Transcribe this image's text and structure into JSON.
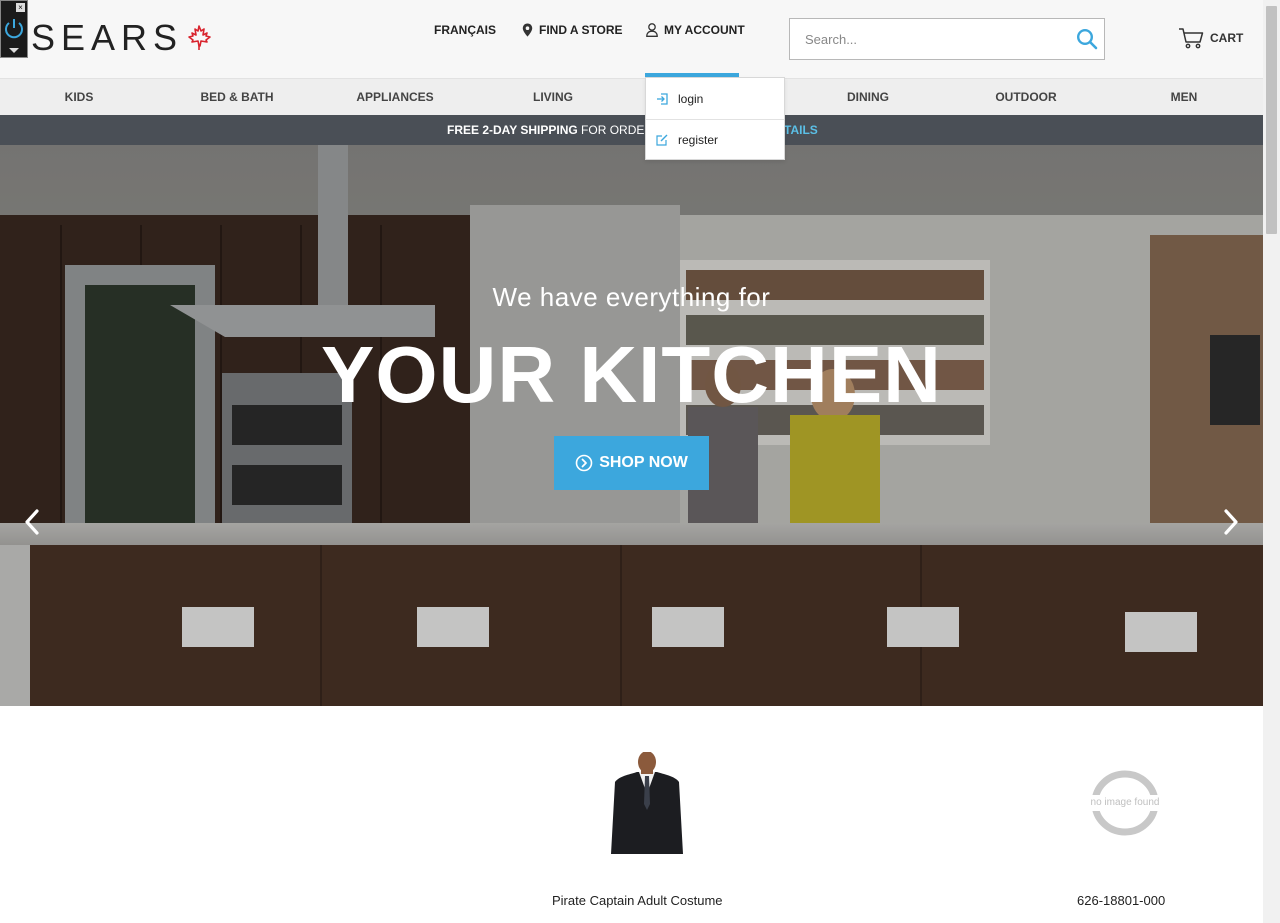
{
  "brand": {
    "logo_text": "SEARS"
  },
  "header": {
    "language_label": "FRANÇAIS",
    "find_store_label": "FIND A STORE",
    "account_label": "MY ACCOUNT",
    "cart_label": "CART"
  },
  "search": {
    "placeholder": "Search...",
    "value": ""
  },
  "account_menu": {
    "items": [
      {
        "label": "login",
        "icon": "login-icon"
      },
      {
        "label": "register",
        "icon": "edit-icon"
      }
    ]
  },
  "categories": [
    {
      "label": "KIDS"
    },
    {
      "label": "BED & BATH"
    },
    {
      "label": "APPLIANCES"
    },
    {
      "label": "LIVING"
    },
    {
      "label": "DINING"
    },
    {
      "label": "OUTDOOR"
    },
    {
      "label": "MEN"
    }
  ],
  "shipping_banner": {
    "bold": "FREE 2-DAY SHIPPING",
    "rest": " FOR ORDE",
    "link": "TAILS"
  },
  "hero": {
    "subtitle": "We have everything for",
    "title": "YOUR KITCHEN",
    "cta_label": "SHOP NOW"
  },
  "products": [
    {
      "name": "Pirate Captain Adult Costume",
      "image": "suit-image"
    },
    {
      "name": "626-18801-000",
      "image": "no-image-found"
    }
  ],
  "placeholder_image": {
    "text": "no image found"
  },
  "colors": {
    "accent": "#3ca7dd",
    "header_bg": "#f7f7f7",
    "nav_bg": "#eeeeee",
    "banner_bg": "#4a4f56",
    "logo_leaf": "#d9232d"
  }
}
